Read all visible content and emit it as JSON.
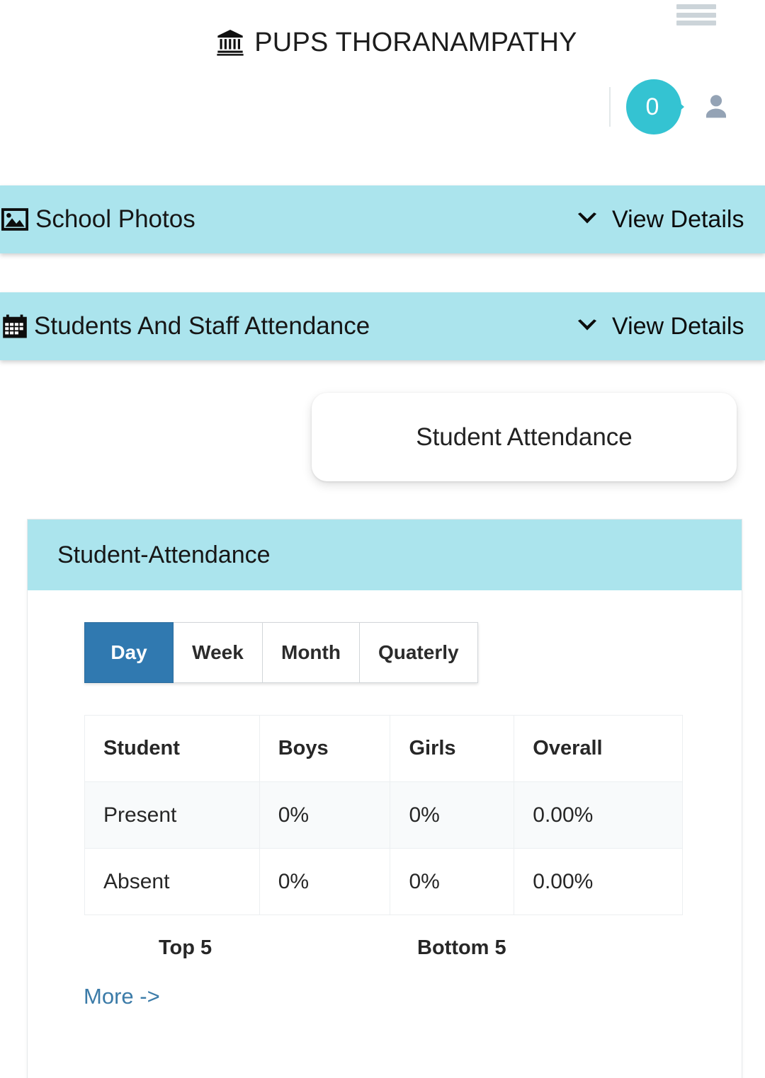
{
  "header": {
    "school_name": "PUPS THORANAMPATHY",
    "school_icon": "bank-icon",
    "menu_icon": "hamburger-menu-icon",
    "notification_count": "0",
    "notification_color": "#34c3d2",
    "avatar_icon": "user-avatar-icon"
  },
  "accordions": [
    {
      "label": "School Photos",
      "icon": "image-icon",
      "action_label": "View Details",
      "action_icon": "chevron-down-icon",
      "bg_color": "#abe4ed"
    },
    {
      "label": "Students And Staff Attendance",
      "icon": "calendar-icon",
      "action_label": "View Details",
      "action_icon": "chevron-down-icon",
      "bg_color": "#abe4ed"
    }
  ],
  "tab_pill": {
    "label": "Student Attendance"
  },
  "card": {
    "title": "Student-Attendance",
    "header_color": "#abe4ed",
    "period_buttons": [
      {
        "label": "Day",
        "active": true
      },
      {
        "label": "Week",
        "active": false
      },
      {
        "label": "Month",
        "active": false
      },
      {
        "label": "Quaterly",
        "active": false
      }
    ],
    "active_period": "Day",
    "active_color": "#3079b0",
    "table": {
      "columns": [
        "Student",
        "Boys",
        "Girls",
        "Overall"
      ],
      "rows": [
        {
          "label": "Present",
          "boys": "0%",
          "girls": "0%",
          "overall": "0.00%",
          "color": "#11b211"
        },
        {
          "label": "Absent",
          "boys": "0%",
          "girls": "0%",
          "overall": "0.00%",
          "color": "#cc2020"
        }
      ]
    },
    "rankings": {
      "top_label": "Top 5",
      "bottom_label": "Bottom 5"
    },
    "more_link": "More ->"
  }
}
